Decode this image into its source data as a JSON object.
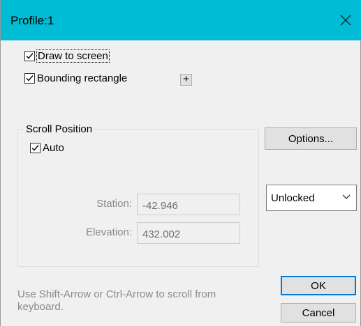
{
  "dialog": {
    "title": "Profile:1",
    "close_icon": "close-icon"
  },
  "checkboxes": {
    "draw_to_screen": {
      "label": "Draw to screen",
      "checked": true
    },
    "bounding_rectangle": {
      "label": "Bounding rectangle",
      "checked": true
    },
    "auto": {
      "label": "Auto",
      "checked": true
    }
  },
  "expand_button": {
    "label": "+"
  },
  "scroll_position": {
    "title": "Scroll Position",
    "station": {
      "label": "Station:",
      "value": "-42.946"
    },
    "elevation": {
      "label": "Elevation:",
      "value": "432.002"
    },
    "hint": "Use Shift-Arrow or Ctrl-Arrow to scroll from keyboard."
  },
  "buttons": {
    "options": "Options...",
    "ok": "OK",
    "cancel": "Cancel"
  },
  "lock_select": {
    "value": "Unlocked",
    "icon": "chevron-down-icon"
  },
  "colors": {
    "titlebar": "#00bcd4",
    "dialog_bg": "#f0f0f0",
    "default_border": "#0078d7"
  }
}
